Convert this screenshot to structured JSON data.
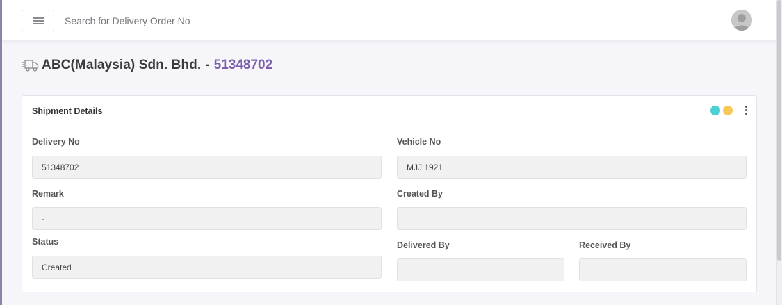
{
  "topbar": {
    "search_placeholder": "Search for Delivery Order No",
    "menu_icon": "hamburger-menu-icon",
    "avatar_icon": "user-avatar-icon"
  },
  "page_header": {
    "icon": "delivery-truck-icon",
    "company": "ABC(Malaysia) Sdn. Bhd.",
    "separator": "-",
    "delivery_number": "51348702",
    "number_color": "#7b5fae"
  },
  "card": {
    "title": "Shipment Details",
    "actions": {
      "dot_colors": [
        "#4dd0d4",
        "#f7c95b"
      ],
      "menu_icon": "kebab-menu-icon"
    },
    "fields": {
      "delivery_no": {
        "label": "Delivery No",
        "value": "51348702"
      },
      "vehicle_no": {
        "label": "Vehicle No",
        "value": "MJJ 1921"
      },
      "remark": {
        "label": "Remark",
        "value": "-"
      },
      "created_by": {
        "label": "Created By",
        "value": ""
      },
      "status": {
        "label": "Status",
        "value": "Created"
      },
      "delivered_by": {
        "label": "Delivered By",
        "value": ""
      },
      "received_by": {
        "label": "Received By",
        "value": ""
      }
    }
  }
}
